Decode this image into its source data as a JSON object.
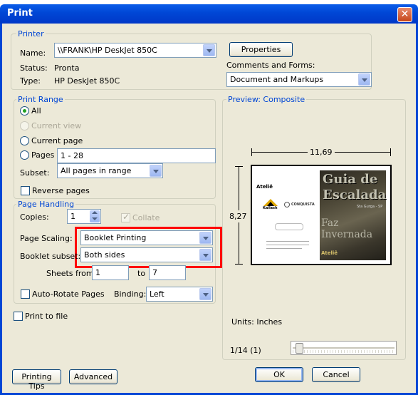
{
  "window": {
    "title": "Print",
    "close_glyph": "✕"
  },
  "printer": {
    "legend": "Printer",
    "name_label": "Name:",
    "name_value": "\\\\FRANK\\HP DeskJet 850C",
    "status_label": "Status:",
    "status_value": "Pronta",
    "type_label": "Type:",
    "type_value": "HP DeskJet 850C",
    "properties_label": "Properties",
    "comments_label": "Comments and Forms:",
    "comments_value": "Document and Markups"
  },
  "print_range": {
    "legend": "Print Range",
    "all_label": "All",
    "current_view_label": "Current view",
    "current_page_label": "Current page",
    "pages_label": "Pages",
    "pages_value": "1 - 28",
    "subset_label": "Subset:",
    "subset_value": "All pages in range",
    "reverse_label": "Reverse pages",
    "selected": "All"
  },
  "page_handling": {
    "legend": "Page Handling",
    "copies_label": "Copies:",
    "copies_value": "1",
    "collate_label": "Collate",
    "scaling_label": "Page Scaling:",
    "scaling_value": "Booklet Printing",
    "subset_label": "Booklet subset:",
    "subset_value": "Both sides",
    "sheets_from_label": "Sheets from",
    "sheets_from_value": "1",
    "to_label": "to",
    "to_value": "7",
    "auto_rotate_label": "Auto-Rotate Pages",
    "binding_label": "Binding:",
    "binding_value": "Left"
  },
  "print_to_file_label": "Print to file",
  "preview": {
    "legend": "Preview: Composite",
    "width_label": "11,69",
    "height_label": "8,27",
    "units_label": "Units: Inches",
    "page_indicator": "1/14 (1)",
    "slider_fraction": 0.0,
    "page_title_line1": "Guia de",
    "page_title_line2": "Escalada",
    "faz_line1": "Faz",
    "faz_line2": "Invernada",
    "brand_kailash": "Kailash",
    "brand_conquista": "CONQUISTA",
    "brand_atelie": "Ateliê",
    "small_text": "Sta Gurga - SP"
  },
  "buttons": {
    "printing_tips": "Printing Tips",
    "advanced": "Advanced",
    "ok": "OK",
    "cancel": "Cancel"
  },
  "colors": {
    "highlight_border": "#ff0000",
    "title_bar": "#0046d5"
  }
}
